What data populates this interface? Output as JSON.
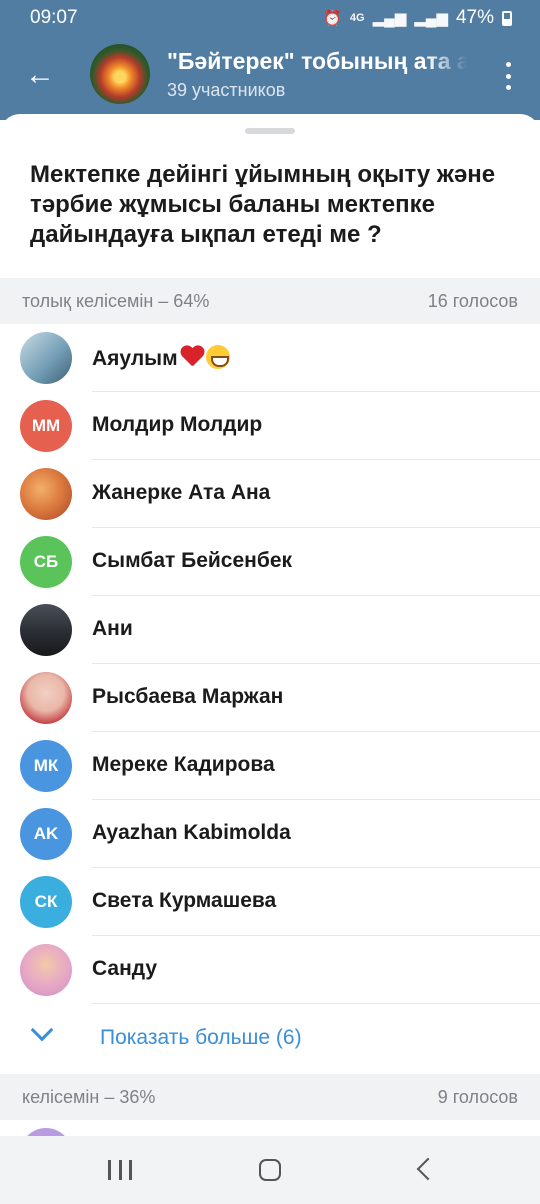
{
  "status_bar": {
    "time": "09:07",
    "network": "4G",
    "battery": "47%"
  },
  "header": {
    "title": "\"Бәйтерек\" тобының ата а",
    "subtitle": "39 участников"
  },
  "poll": {
    "question": "Мектепке дейінгі ұйымның оқыту және тәрбие жұмысы баланы мектепке дайындауға ықпал етеді ме ?",
    "options": [
      {
        "label": "толық келісемін – 64%",
        "votes": "16 голосов",
        "voters": [
          {
            "name": "Аяулым",
            "initials": "",
            "color": "#8bb6c9"
          },
          {
            "name": "Молдир Молдир",
            "initials": "ММ",
            "color": "#e5604e"
          },
          {
            "name": "Жанерке Ата Ана",
            "initials": "",
            "color": "#d9773d"
          },
          {
            "name": "Сымбат Бейсенбек",
            "initials": "СБ",
            "color": "#5ac45a"
          },
          {
            "name": "Ани",
            "initials": "",
            "color": "#2a2d33"
          },
          {
            "name": "Рысбаева Маржан",
            "initials": "",
            "color": "#e9b7a8"
          },
          {
            "name": "Мереке Кадирова",
            "initials": "МК",
            "color": "#4a95e0"
          },
          {
            "name": "Ayazhan Kabimolda",
            "initials": "AK",
            "color": "#4a95e0"
          },
          {
            "name": "Света Курмашева",
            "initials": "СК",
            "color": "#3aaede"
          },
          {
            "name": "Санду",
            "initials": "",
            "color": "#e6a6c7"
          }
        ],
        "show_more": "Показать больше (6)"
      },
      {
        "label": "келісемін – 36%",
        "votes": "9 голосов"
      }
    ]
  }
}
